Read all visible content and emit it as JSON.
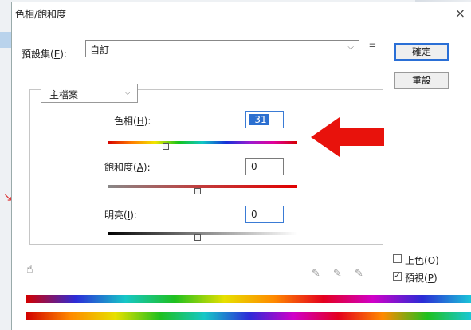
{
  "window": {
    "title": "色相/飽和度",
    "close_glyph": "×"
  },
  "preset": {
    "label_prefix": "預設集(",
    "label_key": "E",
    "label_suffix": "):",
    "value": "自訂",
    "chevron": "⌵",
    "menu_icon": "menu-icon",
    "menu_glyph": "⫶≡"
  },
  "buttons": {
    "ok": "確定",
    "reset": "重設"
  },
  "channel": {
    "value": "主檔案",
    "chevron": "⌵"
  },
  "hue": {
    "label_prefix": "色相(",
    "label_key": "H",
    "label_suffix": "):",
    "value": "-31",
    "level": -31
  },
  "saturation": {
    "label_prefix": "飽和度(",
    "label_key": "A",
    "label_suffix": "):",
    "value": "0",
    "level": 0
  },
  "lightness": {
    "label_prefix": "明亮(",
    "label_key": "I",
    "label_suffix": "):",
    "value": "0",
    "level": 0
  },
  "colorize": {
    "label_prefix": "上色(",
    "label_key": "O",
    "label_suffix": ")",
    "checked": false
  },
  "preview": {
    "label_prefix": "預視(",
    "label_key": "P",
    "label_suffix": ")",
    "checked": true,
    "check_glyph": "✓"
  },
  "tools": {
    "hand": "☝",
    "eyedropper": "✎"
  },
  "colors": {
    "accent": "#2b6fd0",
    "arrow": "#e8120c"
  }
}
